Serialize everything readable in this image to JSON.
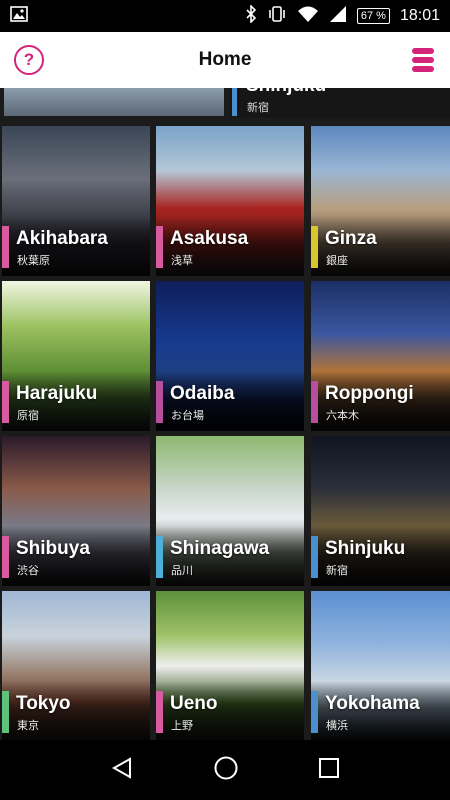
{
  "status_bar": {
    "battery": "67 %",
    "time": "18:01"
  },
  "app_bar": {
    "title": "Home",
    "help_label": "?"
  },
  "top_partial": {
    "name": "Shinjuku",
    "jp": "新宿",
    "accent": "#4b8fcf"
  },
  "tiles": [
    {
      "name": "Akihabara",
      "jp": "秋葉原",
      "accent": "#d85a9f"
    },
    {
      "name": "Asakusa",
      "jp": "浅草",
      "accent": "#d85a9f"
    },
    {
      "name": "Ginza",
      "jp": "銀座",
      "accent": "#d8c62a"
    },
    {
      "name": "Harajuku",
      "jp": "原宿",
      "accent": "#d85a9f"
    },
    {
      "name": "Odaiba",
      "jp": "お台場",
      "accent": "#b84f9e"
    },
    {
      "name": "Roppongi",
      "jp": "六本木",
      "accent": "#b84f9e"
    },
    {
      "name": "Shibuya",
      "jp": "渋谷",
      "accent": "#d85a9f"
    },
    {
      "name": "Shinagawa",
      "jp": "品川",
      "accent": "#4db0d6"
    },
    {
      "name": "Shinjuku",
      "jp": "新宿",
      "accent": "#4b8fcf"
    },
    {
      "name": "Tokyo",
      "jp": "東京",
      "accent": "#5fc27a"
    },
    {
      "name": "Ueno",
      "jp": "上野",
      "accent": "#d85a9f"
    },
    {
      "name": "Yokohama",
      "jp": "横浜",
      "accent": "#4b8fcf"
    }
  ],
  "colors": {
    "brand": "#d4237a"
  },
  "icons": {
    "status_left": "image-icon",
    "bluetooth": "bluetooth-icon",
    "vibrate": "vibrate-icon",
    "wifi": "wifi-icon",
    "signal": "signal-icon",
    "back": "back-triangle-icon",
    "home": "home-icon",
    "recents": "recents-square-icon"
  }
}
